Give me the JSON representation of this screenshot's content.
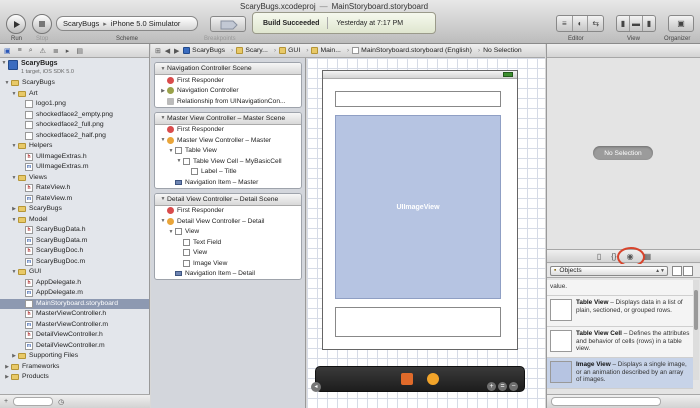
{
  "window": {
    "project": "ScaryBugs.xcodeproj",
    "file": "MainStoryboard.storyboard"
  },
  "toolbar": {
    "run": "Run",
    "stop": "Stop",
    "scheme_target": "ScaryBugs",
    "scheme_device": "iPhone 5.0 Simulator",
    "scheme_label": "Scheme",
    "breakpoints": "Breakpoints",
    "editor": "Editor",
    "view": "View",
    "organizer": "Organizer",
    "activity_status": "Build Succeeded",
    "activity_time": "Yesterday at 7:17 PM"
  },
  "navigator": {
    "project_name": "ScaryBugs",
    "project_sub": "1 target, iOS SDK 5.0",
    "items": [
      {
        "label": "ScaryBugs",
        "icon": "folder",
        "indent": 1,
        "tri": "▼"
      },
      {
        "label": "Art",
        "icon": "folder",
        "indent": 2,
        "tri": "▼"
      },
      {
        "label": "logo1.png",
        "icon": "png",
        "indent": 3,
        "tri": ""
      },
      {
        "label": "shockedface2_empty.png",
        "icon": "png",
        "indent": 3,
        "tri": ""
      },
      {
        "label": "shockedface2_full.png",
        "icon": "png",
        "indent": 3,
        "tri": ""
      },
      {
        "label": "shockedface2_half.png",
        "icon": "png",
        "indent": 3,
        "tri": ""
      },
      {
        "label": "Helpers",
        "icon": "folder",
        "indent": 2,
        "tri": "▼"
      },
      {
        "label": "UIImageExtras.h",
        "icon": "h",
        "indent": 3,
        "tri": ""
      },
      {
        "label": "UIImageExtras.m",
        "icon": "m",
        "indent": 3,
        "tri": ""
      },
      {
        "label": "Views",
        "icon": "folder",
        "indent": 2,
        "tri": "▼"
      },
      {
        "label": "RateView.h",
        "icon": "h",
        "indent": 3,
        "tri": ""
      },
      {
        "label": "RateView.m",
        "icon": "m",
        "indent": 3,
        "tri": ""
      },
      {
        "label": "ScaryBugs",
        "icon": "folder",
        "indent": 2,
        "tri": "▶"
      },
      {
        "label": "Model",
        "icon": "folder",
        "indent": 2,
        "tri": "▼"
      },
      {
        "label": "ScaryBugData.h",
        "icon": "h",
        "indent": 3,
        "tri": ""
      },
      {
        "label": "ScaryBugData.m",
        "icon": "m",
        "indent": 3,
        "tri": ""
      },
      {
        "label": "ScaryBugDoc.h",
        "icon": "h",
        "indent": 3,
        "tri": ""
      },
      {
        "label": "ScaryBugDoc.m",
        "icon": "m",
        "indent": 3,
        "tri": ""
      },
      {
        "label": "GUI",
        "icon": "folder",
        "indent": 2,
        "tri": "▼"
      },
      {
        "label": "AppDelegate.h",
        "icon": "h",
        "indent": 3,
        "tri": ""
      },
      {
        "label": "AppDelegate.m",
        "icon": "m",
        "indent": 3,
        "tri": ""
      },
      {
        "label": "MainStoryboard.storyboard",
        "icon": "sb",
        "indent": 3,
        "tri": "",
        "selected": true
      },
      {
        "label": "MasterViewController.h",
        "icon": "h",
        "indent": 3,
        "tri": ""
      },
      {
        "label": "MasterViewController.m",
        "icon": "m",
        "indent": 3,
        "tri": ""
      },
      {
        "label": "DetailViewController.h",
        "icon": "h",
        "indent": 3,
        "tri": ""
      },
      {
        "label": "DetailViewController.m",
        "icon": "m",
        "indent": 3,
        "tri": ""
      },
      {
        "label": "Supporting Files",
        "icon": "folder",
        "indent": 2,
        "tri": "▶"
      },
      {
        "label": "Frameworks",
        "icon": "folder",
        "indent": 1,
        "tri": "▶"
      },
      {
        "label": "Products",
        "icon": "folder",
        "indent": 1,
        "tri": "▶"
      }
    ]
  },
  "jumpbar": {
    "crumbs": [
      "ScaryBugs",
      "Scary...",
      "GUI",
      "Main...",
      "MainStoryboard.storyboard (English)",
      "No Selection"
    ]
  },
  "outline": {
    "scenes": [
      {
        "title": "Navigation Controller Scene",
        "rows": [
          {
            "label": "First Responder",
            "icon": "fr",
            "indent": 1,
            "tri": ""
          },
          {
            "label": "Navigation Controller",
            "icon": "nc",
            "indent": 1,
            "tri": "▶"
          },
          {
            "label": "Relationship from UINavigationCon...",
            "icon": "rel",
            "indent": 1,
            "tri": ""
          }
        ]
      },
      {
        "title": "Master View Controller – Master Scene",
        "rows": [
          {
            "label": "First Responder",
            "icon": "fr",
            "indent": 1,
            "tri": ""
          },
          {
            "label": "Master View Controller – Master",
            "icon": "vc",
            "indent": 1,
            "tri": "▼"
          },
          {
            "label": "Table View",
            "icon": "view",
            "indent": 2,
            "tri": "▼"
          },
          {
            "label": "Table View Cell – MyBasicCell",
            "icon": "view",
            "indent": 3,
            "tri": "▼"
          },
          {
            "label": "Label – Title",
            "icon": "view",
            "indent": 4,
            "tri": ""
          },
          {
            "label": "Navigation Item – Master",
            "icon": "ni",
            "indent": 2,
            "tri": ""
          }
        ]
      },
      {
        "title": "Detail View Controller – Detail Scene",
        "rows": [
          {
            "label": "First Responder",
            "icon": "fr",
            "indent": 1,
            "tri": ""
          },
          {
            "label": "Detail View Controller – Detail",
            "icon": "vc",
            "indent": 1,
            "tri": "▼"
          },
          {
            "label": "View",
            "icon": "view",
            "indent": 2,
            "tri": "▼"
          },
          {
            "label": "Text Field",
            "icon": "view",
            "indent": 3,
            "tri": ""
          },
          {
            "label": "View",
            "icon": "view",
            "indent": 3,
            "tri": ""
          },
          {
            "label": "Image View",
            "icon": "view",
            "indent": 3,
            "tri": ""
          },
          {
            "label": "Navigation Item – Detail",
            "icon": "ni",
            "indent": 2,
            "tri": ""
          }
        ]
      }
    ]
  },
  "canvas": {
    "image_view_label": "UIImageView"
  },
  "utilities": {
    "no_selection": "No Selection",
    "library_select": "Objects",
    "library_items": [
      {
        "title": "",
        "desc": "value.",
        "thumb": "blank"
      },
      {
        "title": "Table View",
        "desc": " – Displays data in a list of plain, sectioned, or grouped rows.",
        "thumb": "blank"
      },
      {
        "title": "Table View Cell",
        "desc": " – Defines the attributes and behavior of cells (rows) in a table view.",
        "thumb": "blank"
      },
      {
        "title": "Image View",
        "desc": " – Displays a single image, or an animation described by an array of images.",
        "thumb": "img",
        "selected": true
      }
    ]
  },
  "colors": {
    "selection": "#8d99b1",
    "image_view": "#b6c4e2",
    "highlight_circle": "#d8442c"
  }
}
